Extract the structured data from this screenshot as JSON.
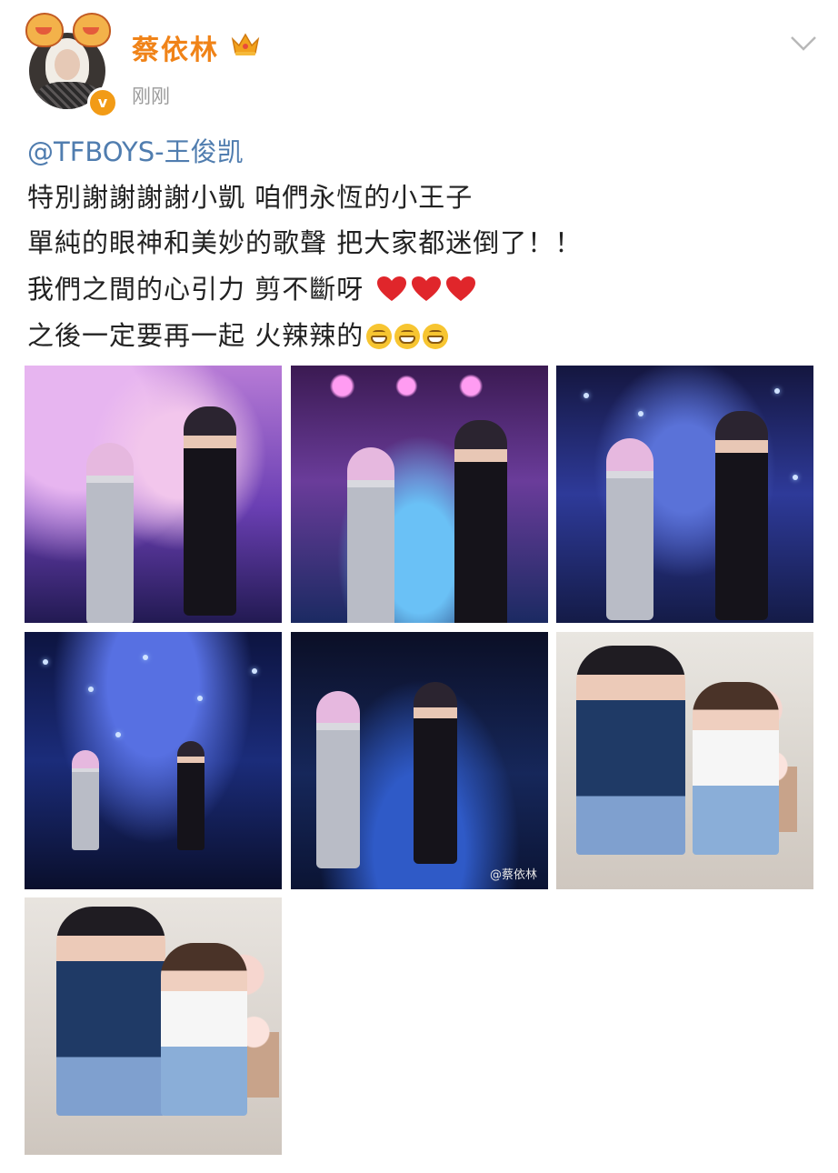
{
  "header": {
    "username": "蔡依林",
    "timestamp": "刚刚"
  },
  "post": {
    "mention": "@TFBOYS-王俊凯",
    "lines": [
      "特別謝謝謝謝小凱 咱們永恆的小王子",
      "單純的眼神和美妙的歌聲 把大家都迷倒了！！",
      "我們之間的心引力  剪不斷呀",
      "之後一定要再一起 火辣辣的"
    ]
  },
  "photos": {
    "count": 7,
    "watermark": "@蔡依林"
  },
  "colors": {
    "username": "#f08318",
    "mention": "#507daf",
    "verified_badge": "#f29b16"
  },
  "icons": [
    "crown-icon",
    "chevron-down-icon",
    "verified-badge-icon",
    "heart-emoji",
    "grin-emoji"
  ]
}
